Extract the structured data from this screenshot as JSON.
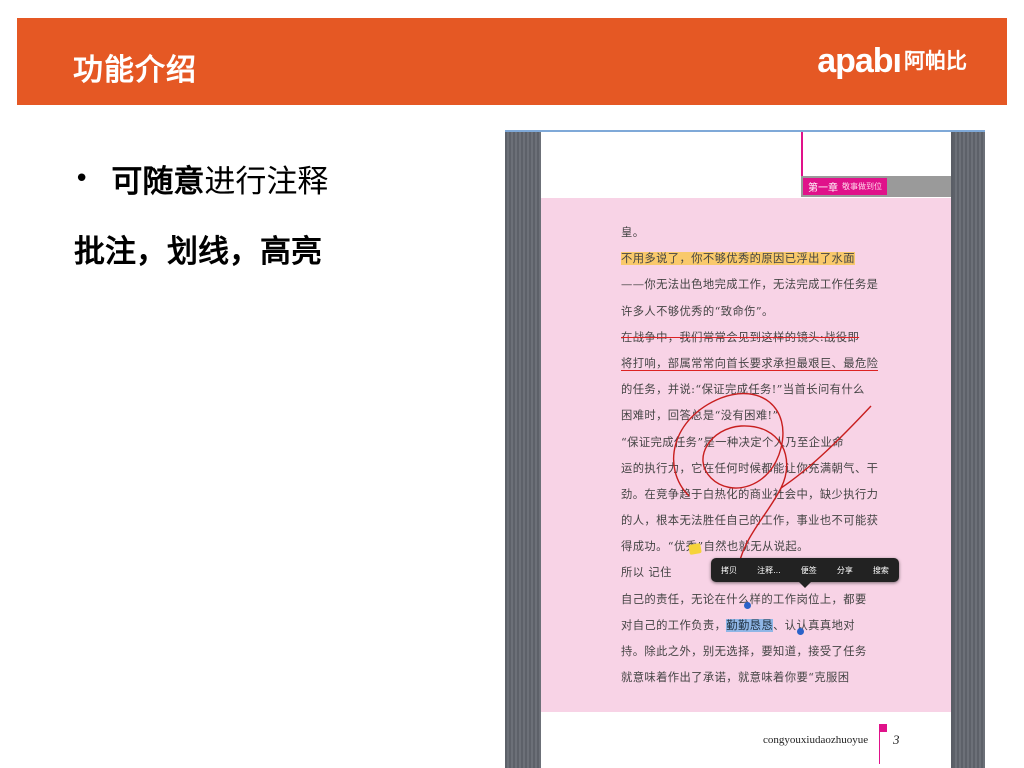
{
  "header": {
    "title": "功能介绍",
    "logo_latin": "apabı",
    "logo_cn": "阿帕比",
    "bg_color": "#E55824"
  },
  "content": {
    "bullet": "•",
    "line1_strong": "可随意",
    "line1_rest": "进行注释",
    "line2": "批注，划线，高亮"
  },
  "screenshot": {
    "chapter_label": "第一章",
    "chapter_sub": "敬事做到位",
    "lines": [
      "皇。",
      "不用多说了，你不够优秀的原因已浮出了水面",
      "——你无法出色地完成工作，无法完成工作任务是",
      "许多人不够优秀的“致命伤”。",
      "在战争中，我们常常会见到这样的镜头:战役即",
      "将打响，部属常常向首长要求承担最艰巨、最危险",
      "的任务，并说:“保证完成任务!”当首长问有什么",
      "困难时，回答总是“没有困难!”",
      "“保证完成任务”是一种决定个人乃至企业命",
      "运的执行力，它在任何时候都能让你充满朝气、干",
      "劲。在竞争趋于白热化的商业社会中，缺少执行力",
      "的人，根本无法胜任自己的工作，事业也不可能获",
      "得成功。“优秀”自然也就无从说起。",
      "所以                                             记住",
      "自己的责任，无论在什么样的工作岗位上，都要",
      "对自己的工作负责，",
      "持。除此之外，别无选择，要知道，接受了任务",
      "就意味着作出了承诺，就意味着你要“克服困"
    ],
    "selected_text": "勤勤恳恳",
    "line16_tail": "、认认真真地对",
    "popup_items": [
      "拷贝",
      "注释...",
      "便签",
      "分享",
      "搜索"
    ],
    "footer_text": "congyouxiudaozhuoyue",
    "page_number": "3"
  }
}
